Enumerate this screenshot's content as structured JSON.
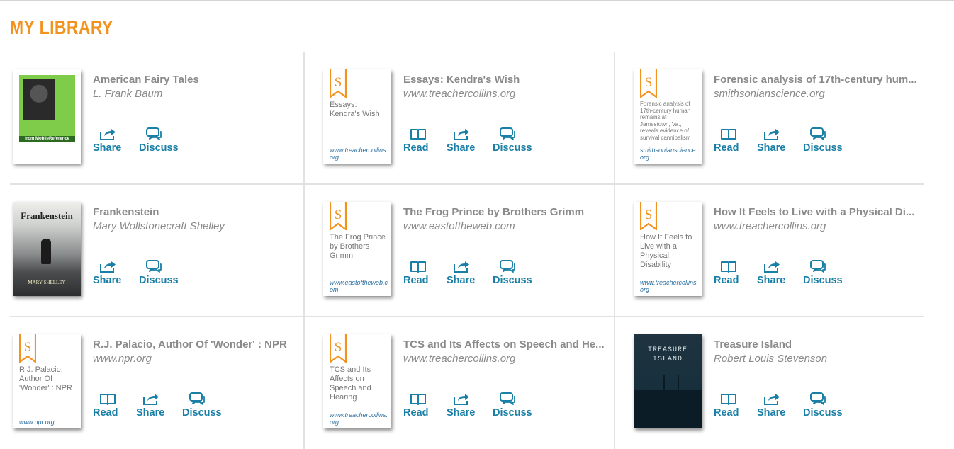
{
  "page": {
    "title": "MY LIBRARY"
  },
  "items": [
    {
      "title": "American Fairy Tales",
      "subtitle": "L. Frank Baum",
      "cover": "photo-fairy",
      "cover_banner": "from MobileReference",
      "actions": [
        "Share",
        "Discuss"
      ]
    },
    {
      "title": "Essays: Kendra's Wish",
      "subtitle": "www.treachercollins.org",
      "cover": "generic",
      "cover_title": "Essays: Kendra's Wish",
      "cover_source": "www.treachercollins.org",
      "actions": [
        "Read",
        "Share",
        "Discuss"
      ]
    },
    {
      "title": "Forensic analysis of 17th-century hum...",
      "subtitle": "smithsonianscience.org",
      "cover": "generic-small",
      "cover_title": "Forensic analysis of 17th-century human remains at Jamestown, Va., reveals evidence of survival cannibalism",
      "cover_source": "smithsonianscience.org",
      "actions": [
        "Read",
        "Share",
        "Discuss"
      ]
    },
    {
      "title": "Frankenstein",
      "subtitle": "Mary Wollstonecraft Shelley",
      "cover": "photo-frank",
      "cover_heading": "Frankenstein",
      "cover_author": "MARY SHELLEY",
      "actions": [
        "Share",
        "Discuss"
      ]
    },
    {
      "title": "The Frog Prince by Brothers Grimm",
      "subtitle": "www.eastoftheweb.com",
      "cover": "generic",
      "cover_title": "The Frog Prince by Brothers Grimm",
      "cover_source": "www.eastoftheweb.com",
      "actions": [
        "Read",
        "Share",
        "Discuss"
      ]
    },
    {
      "title": "How It Feels to Live with a Physical Di...",
      "subtitle": "www.treachercollins.org",
      "cover": "generic",
      "cover_title": "How It Feels to Live with a Physical Disability",
      "cover_source": "www.treachercollins.org",
      "actions": [
        "Read",
        "Share",
        "Discuss"
      ]
    },
    {
      "title": "R.J. Palacio, Author Of 'Wonder' : NPR",
      "subtitle": "www.npr.org",
      "cover": "generic",
      "cover_title": "R.J. Palacio, Author Of 'Wonder' : NPR",
      "cover_source": "www.npr.org",
      "actions": [
        "Read",
        "Share",
        "Discuss"
      ]
    },
    {
      "title": "TCS and Its Affects on Speech and He...",
      "subtitle": "www.treachercollins.org",
      "cover": "generic",
      "cover_title": "TCS and Its Affects on Speech and Hearing",
      "cover_source": "www.treachercollins.org",
      "actions": [
        "Read",
        "Share",
        "Discuss"
      ]
    },
    {
      "title": "Treasure Island",
      "subtitle": "Robert Louis Stevenson",
      "cover": "photo-treasure",
      "cover_heading": "TREASURE ISLAND",
      "actions": [
        "Read",
        "Share",
        "Discuss"
      ]
    }
  ],
  "colors": {
    "accent": "#f2931f",
    "link": "#1a7fa6",
    "muted": "#8a8a8a"
  },
  "icons": {
    "Read": "book-icon",
    "Share": "share-icon",
    "Discuss": "discuss-icon"
  }
}
